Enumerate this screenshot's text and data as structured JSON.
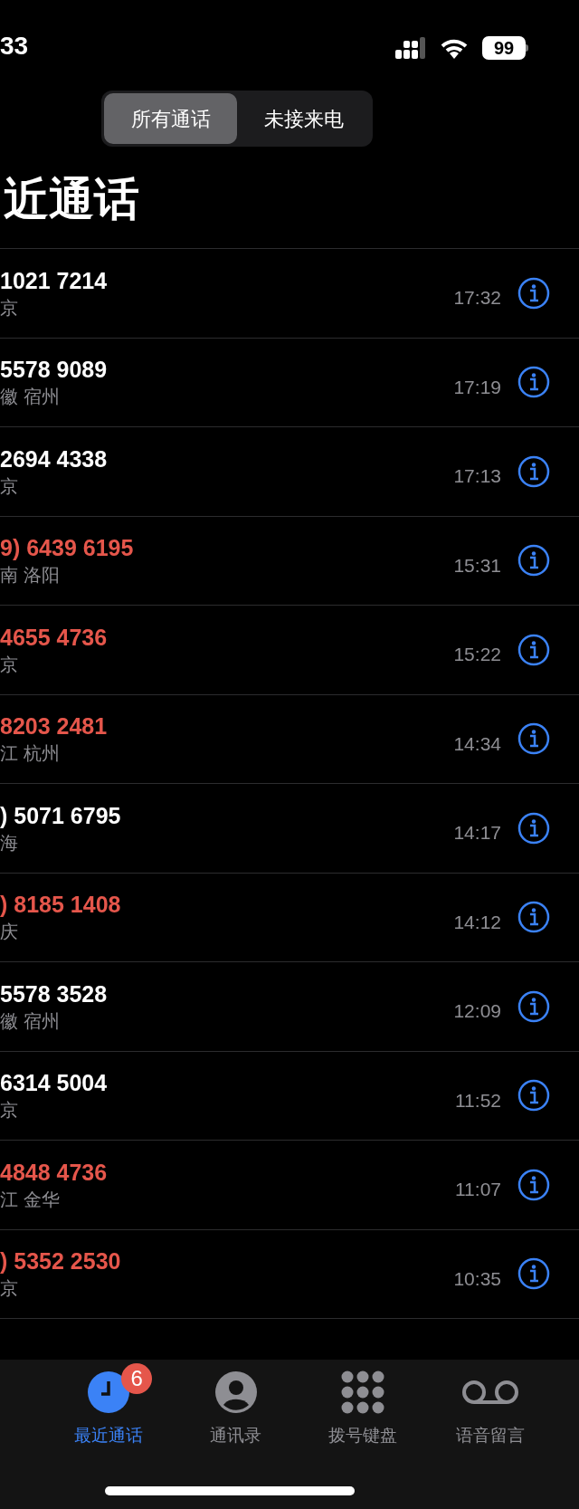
{
  "status_bar": {
    "time": "33",
    "battery": "99"
  },
  "segments": [
    {
      "label": "所有通话",
      "selected": true
    },
    {
      "label": "未接来电",
      "selected": false
    }
  ],
  "title": "近通话",
  "calls": [
    {
      "number": "1021 7214",
      "location": "京",
      "time": "17:32",
      "missed": false
    },
    {
      "number": "5578 9089",
      "location": "徽 宿州",
      "time": "17:19",
      "missed": false
    },
    {
      "number": "2694 4338",
      "location": "京",
      "time": "17:13",
      "missed": false
    },
    {
      "number": "9) 6439 6195",
      "location": "南 洛阳",
      "time": "15:31",
      "missed": true
    },
    {
      "number": "4655 4736",
      "location": "京",
      "time": "15:22",
      "missed": true
    },
    {
      "number": "8203 2481",
      "location": "江 杭州",
      "time": "14:34",
      "missed": true
    },
    {
      "number": ") 5071 6795",
      "location": "海",
      "time": "14:17",
      "missed": false
    },
    {
      "number": ") 8185 1408",
      "location": "庆",
      "time": "14:12",
      "missed": true
    },
    {
      "number": "5578 3528",
      "location": "徽 宿州",
      "time": "12:09",
      "missed": false
    },
    {
      "number": "6314 5004",
      "location": "京",
      "time": "11:52",
      "missed": false
    },
    {
      "number": "4848 4736",
      "location": "江 金华",
      "time": "11:07",
      "missed": true
    },
    {
      "number": ") 5352 2530",
      "location": "京",
      "time": "10:35",
      "missed": true
    }
  ],
  "tab_bar": [
    {
      "label": "最近通话",
      "kind": "recents",
      "selected": true,
      "badge": "6"
    },
    {
      "label": "通讯录",
      "kind": "contacts",
      "selected": false
    },
    {
      "label": "拨号键盘",
      "kind": "keypad",
      "selected": false
    },
    {
      "label": "语音留言",
      "kind": "voicemail",
      "selected": false
    }
  ]
}
